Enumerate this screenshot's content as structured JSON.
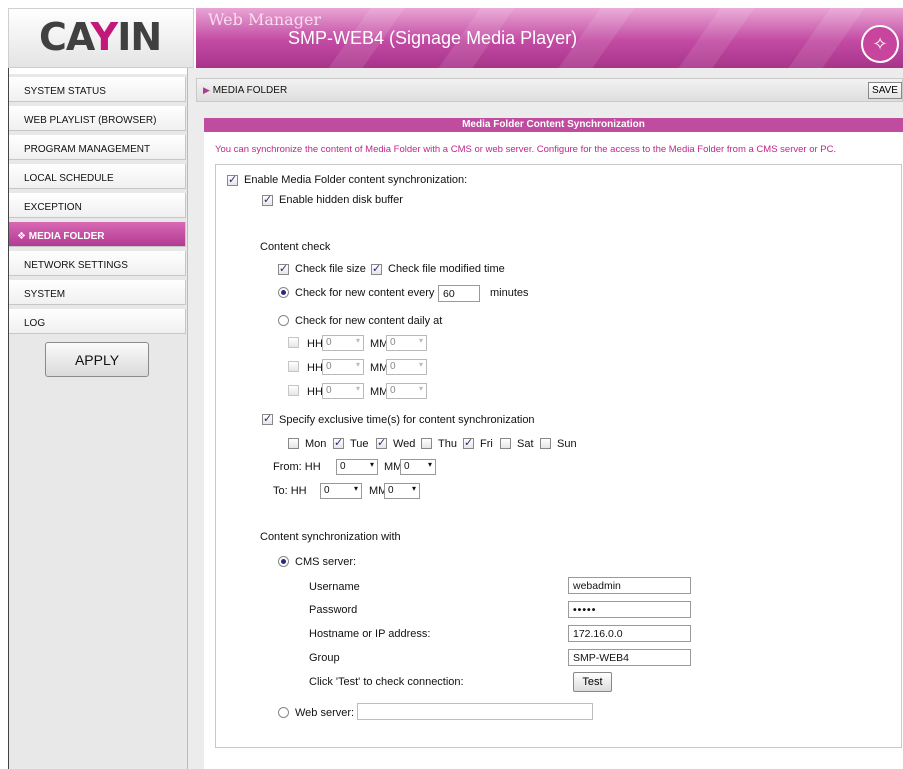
{
  "header": {
    "logo_text": "CAYIN",
    "title": "Web Manager",
    "subtitle": "SMP-WEB4 (Signage Media Player)",
    "wand_icon": "magic-wand-icon",
    "accent_color": "#c2187a"
  },
  "sidebar": {
    "items": [
      {
        "label": "SYSTEM STATUS"
      },
      {
        "label": "WEB PLAYLIST (BROWSER)"
      },
      {
        "label": "PROGRAM MANAGEMENT"
      },
      {
        "label": "LOCAL SCHEDULE"
      },
      {
        "label": "EXCEPTION"
      },
      {
        "label": "❖ MEDIA FOLDER",
        "active": true
      },
      {
        "label": "NETWORK SETTINGS"
      },
      {
        "label": "SYSTEM"
      },
      {
        "label": "LOG"
      }
    ],
    "apply_label": "APPLY"
  },
  "breadcrumb": {
    "label": "MEDIA FOLDER",
    "arrow": "▶",
    "save_label": "SAVE"
  },
  "panel": {
    "title": "Media Folder Content Synchronization",
    "description": "You can synchronize the content of Media Folder with a CMS or web server. Configure for the access to the Media Folder from a CMS server or PC.",
    "enable_sync_label": "Enable Media Folder content synchronization:",
    "enable_sync_checked": true,
    "hidden_buffer_label": "Enable hidden disk buffer",
    "hidden_buffer_checked": true,
    "content_check_heading": "Content check",
    "check_file_size_label": "Check file size",
    "check_modified_label": "Check file modified time",
    "check_every_label": "Check for new content every",
    "check_every_value": "60",
    "minutes_label": "minutes",
    "check_daily_label": "Check for new content daily at",
    "hh_label": "HH",
    "mm_label": "MM",
    "daily_times": [
      {
        "hh": "0",
        "mm": "0"
      },
      {
        "hh": "0",
        "mm": "0"
      },
      {
        "hh": "0",
        "mm": "0"
      }
    ],
    "exclusive_label": "Specify exclusive time(s) for content synchronization",
    "exclusive_checked": true,
    "days": [
      {
        "label": "Mon",
        "checked": false
      },
      {
        "label": "Tue",
        "checked": true
      },
      {
        "label": "Wed",
        "checked": true
      },
      {
        "label": "Thu",
        "checked": false
      },
      {
        "label": "Fri",
        "checked": true
      },
      {
        "label": "Sat",
        "checked": false
      },
      {
        "label": "Sun",
        "checked": false
      }
    ],
    "from_label": "From: HH",
    "to_label": "To: HH",
    "from_hh": "0",
    "from_mm": "0",
    "to_hh": "0",
    "to_mm": "0",
    "sync_with_heading": "Content synchronization with",
    "cms_label": "CMS server:",
    "cms_selected": true,
    "username_label": "Username",
    "username_value": "webadmin",
    "password_label": "Password",
    "password_value": "•••••",
    "hostname_label": "Hostname or IP address:",
    "hostname_value": "172.16.0.0",
    "group_label": "Group",
    "group_value": "SMP-WEB4",
    "test_hint_label": "Click 'Test' to check connection:",
    "test_label": "Test",
    "web_server_label": "Web server:",
    "web_server_value": ""
  }
}
